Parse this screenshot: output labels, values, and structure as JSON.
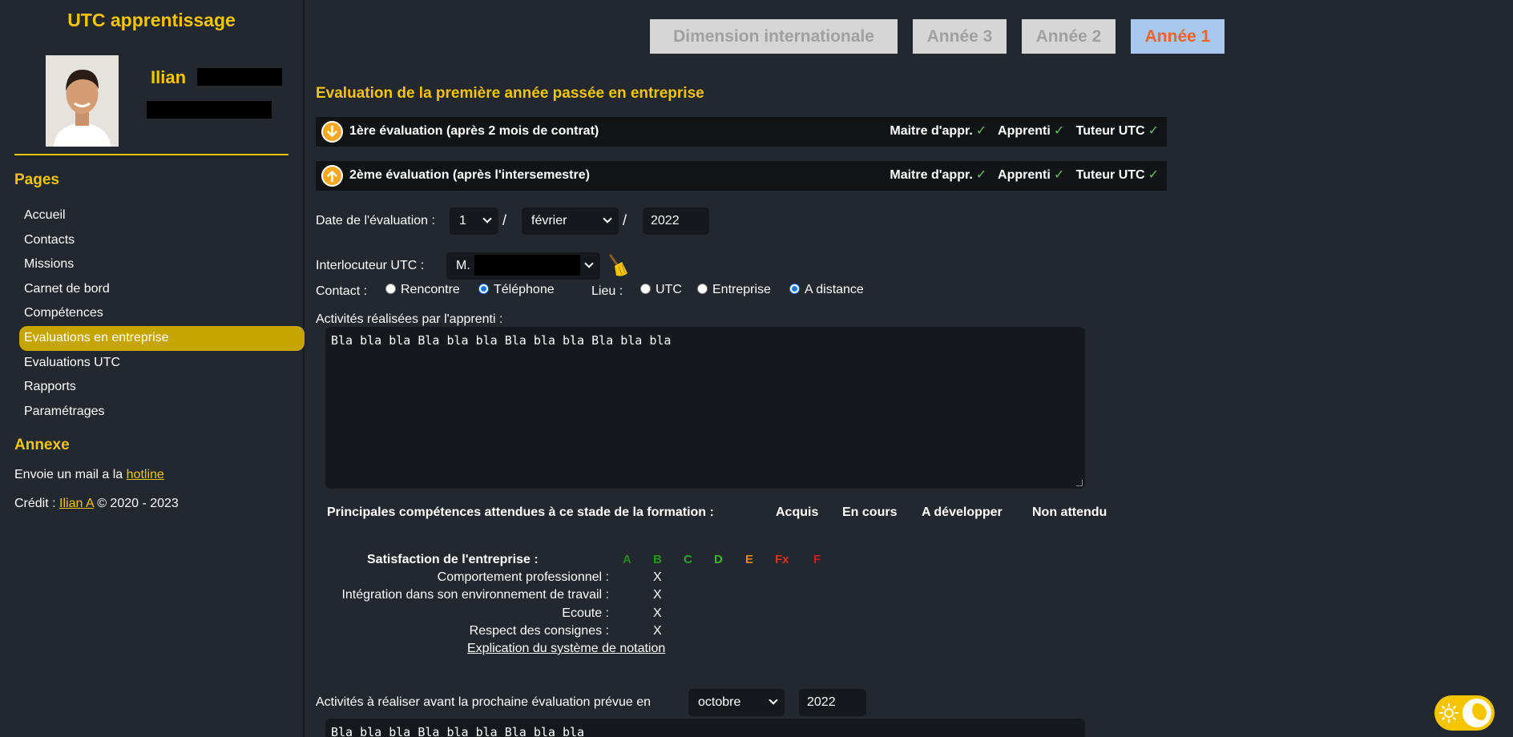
{
  "sidebar": {
    "app_title": "UTC apprentissage",
    "user_first_name": "Ilian",
    "pages_title": "Pages",
    "nav": [
      {
        "label": "Accueil"
      },
      {
        "label": "Contacts"
      },
      {
        "label": "Missions"
      },
      {
        "label": "Carnet de bord"
      },
      {
        "label": "Compétences"
      },
      {
        "label": "Evaluations en entreprise"
      },
      {
        "label": "Evaluations UTC"
      },
      {
        "label": "Rapports"
      },
      {
        "label": "Paramétrages"
      }
    ],
    "active_nav": "Evaluations en entreprise",
    "annexe_title": "Annexe",
    "mail_text": "Envoie un mail a la",
    "hotline_link": "hotline",
    "credit_text": "Crédit :",
    "credit_link": "Ilian A",
    "copyright": "© 2020 - 2023"
  },
  "tabs": [
    {
      "label": "Dimension internationale",
      "active": false
    },
    {
      "label": "Année 3",
      "active": false
    },
    {
      "label": "Année 2",
      "active": false
    },
    {
      "label": "Année 1",
      "active": true
    }
  ],
  "main": {
    "title": "Evaluation de la première année passée en entreprise",
    "evaluations": [
      {
        "label": "1ère évaluation (après 2 mois de contrat)",
        "icon": "arrow-down-icon",
        "status": [
          "Maitre d'appr.",
          "Apprenti",
          "Tuteur UTC"
        ]
      },
      {
        "label": "2ème évaluation (après l'intersemestre)",
        "icon": "arrow-up-icon",
        "status": [
          "Maitre d'appr.",
          "Apprenti",
          "Tuteur UTC"
        ]
      }
    ],
    "check_mark": "✓",
    "date_label": "Date de l'évaluation :",
    "date_day": "1",
    "date_month": "février",
    "date_year": "2022",
    "date_sep": "/",
    "interlocutor_label": "Interlocuteur UTC :",
    "interlocutor_prefix": "M.",
    "contact_label": "Contact :",
    "contact_options": [
      {
        "label": "Rencontre",
        "checked": false
      },
      {
        "label": "Téléphone",
        "checked": true
      }
    ],
    "lieu_label": "Lieu :",
    "lieu_options": [
      {
        "label": "UTC",
        "checked": false
      },
      {
        "label": "Entreprise",
        "checked": false
      },
      {
        "label": "A distance",
        "checked": true
      }
    ],
    "activities_label": "Activités réalisées par l'apprenti :",
    "activities_text": "Bla bla bla Bla bla bla Bla bla bla Bla bla bla",
    "competences_header": {
      "title": "Principales compétences attendues à ce stade de la formation :",
      "columns": [
        "Acquis",
        "En cours",
        "A développer",
        "Non attendu"
      ]
    },
    "satisfaction": {
      "title": "Satisfaction de l'entreprise :",
      "grades": [
        {
          "label": "A",
          "color": "#1e8a1e"
        },
        {
          "label": "B",
          "color": "#1e9a1e"
        },
        {
          "label": "C",
          "color": "#2aa52a"
        },
        {
          "label": "D",
          "color": "#3aba2a"
        },
        {
          "label": "E",
          "color": "#e08a00"
        },
        {
          "label": "Fx",
          "color": "#e0301e"
        },
        {
          "label": "F",
          "color": "#c81e1e"
        }
      ],
      "criteria": [
        {
          "label": "Comportement professionnel :",
          "mark": "X"
        },
        {
          "label": "Intégration dans son environnement de travail :",
          "mark": "X"
        },
        {
          "label": "Ecoute :",
          "mark": "X"
        },
        {
          "label": "Respect des consignes :",
          "mark": "X"
        }
      ],
      "explanation_link": "Explication du système de notation"
    },
    "next_label": "Activités à réaliser avant la prochaine évaluation prévue en",
    "next_month": "octobre",
    "next_year": "2022",
    "next_text": "Bla bla bla Bla bla bla Bla bla bla"
  }
}
